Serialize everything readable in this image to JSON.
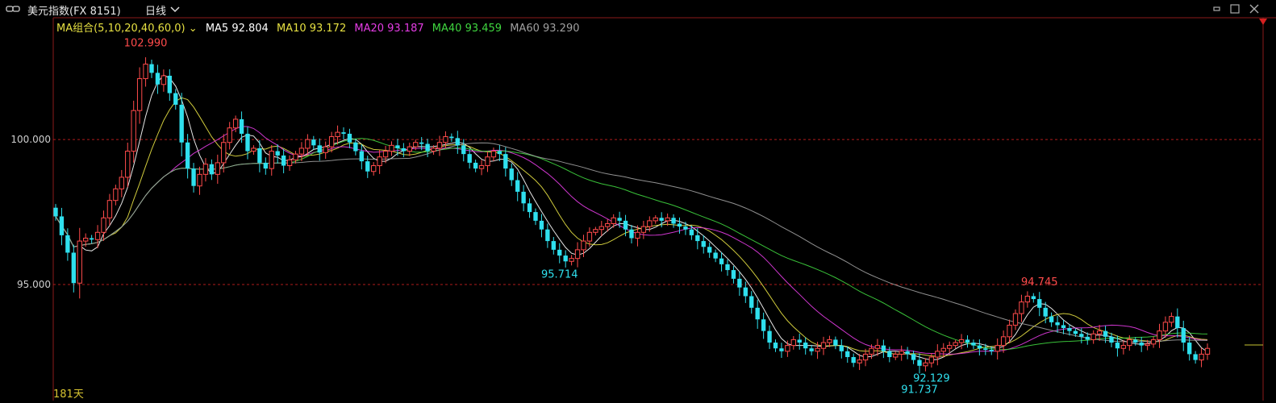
{
  "header": {
    "link_icon": "link-icon",
    "title": "美元指数(FX 8151)",
    "period": "日线",
    "dropdown_icon": "chevron-down-icon",
    "window_controls": [
      "restore-icon",
      "maximize-icon",
      "close-icon"
    ]
  },
  "legend": {
    "group": "MA组合(5,10,20,40,60,0)",
    "ma5": "MA5 92.804",
    "ma10": "MA10 93.172",
    "ma20": "MA20 93.187",
    "ma40": "MA40 93.459",
    "ma60": "MA60 93.290"
  },
  "colors": {
    "up": "#ff4b4b",
    "down": "#2fe0ee",
    "ma5": "#ffffff",
    "ma10": "#e6e042",
    "ma20": "#e43ce4",
    "ma40": "#3fd63f",
    "ma60": "#a0a0a0",
    "grid": "#b01c1c",
    "axis": "#8b1a1a"
  },
  "y_ticks": [
    "100.000",
    "95.000"
  ],
  "footer": {
    "days": "181天"
  },
  "chart_data": {
    "type": "candlestick",
    "title": "美元指数(FX 8151)",
    "ylim": [
      91.0,
      104.2
    ],
    "y_ticks": [
      100.0,
      95.0
    ],
    "gridlines": [
      100.0,
      95.0
    ],
    "annotations": [
      {
        "label": "102.990",
        "value": 102.99,
        "kind": "high"
      },
      {
        "label": "95.714",
        "value": 95.714,
        "kind": "low"
      },
      {
        "label": "94.745",
        "value": 94.745,
        "kind": "high"
      },
      {
        "label": "91.737",
        "value": 91.737,
        "kind": "low"
      },
      {
        "label": "92.129",
        "value": 92.129,
        "kind": "low"
      }
    ],
    "close": [
      97.35,
      96.7,
      96.1,
      95.05,
      96.5,
      96.6,
      96.55,
      96.8,
      97.3,
      97.9,
      98.3,
      98.7,
      99.6,
      101.0,
      102.1,
      102.6,
      102.3,
      101.9,
      102.2,
      101.6,
      101.2,
      99.9,
      99.0,
      98.4,
      98.8,
      99.15,
      98.8,
      99.2,
      99.9,
      100.4,
      100.7,
      100.2,
      99.6,
      99.7,
      99.2,
      99.0,
      99.6,
      99.45,
      99.1,
      99.3,
      99.5,
      99.7,
      100.0,
      99.8,
      99.55,
      99.75,
      100.1,
      100.25,
      100.2,
      99.9,
      99.6,
      99.25,
      98.9,
      99.1,
      99.4,
      99.6,
      99.8,
      99.7,
      99.6,
      99.75,
      99.9,
      99.85,
      99.6,
      99.7,
      99.9,
      100.1,
      100.05,
      99.8,
      99.5,
      99.2,
      99.0,
      99.1,
      99.4,
      99.6,
      99.5,
      99.0,
      98.6,
      98.2,
      97.8,
      97.5,
      97.2,
      96.9,
      96.5,
      96.2,
      96.0,
      95.8,
      95.9,
      96.2,
      96.5,
      96.8,
      96.9,
      97.0,
      97.1,
      97.3,
      97.2,
      96.9,
      96.6,
      96.8,
      97.0,
      97.2,
      97.3,
      97.2,
      97.3,
      97.1,
      97.0,
      96.9,
      96.7,
      96.5,
      96.3,
      96.1,
      95.9,
      95.7,
      95.5,
      95.2,
      94.9,
      94.6,
      94.2,
      93.8,
      93.4,
      93.0,
      92.8,
      92.7,
      92.9,
      93.1,
      93.0,
      92.8,
      92.7,
      92.8,
      93.0,
      93.1,
      92.9,
      92.7,
      92.5,
      92.3,
      92.4,
      92.6,
      92.8,
      92.9,
      92.7,
      92.5,
      92.6,
      92.7,
      92.6,
      92.4,
      92.2,
      92.3,
      92.5,
      92.7,
      92.8,
      92.9,
      93.0,
      93.1,
      93.0,
      92.9,
      92.8,
      92.75,
      92.7,
      92.9,
      93.2,
      93.6,
      94.0,
      94.4,
      94.6,
      94.5,
      94.2,
      93.9,
      93.7,
      93.6,
      93.5,
      93.4,
      93.3,
      93.2,
      93.1,
      93.3,
      93.4,
      93.2,
      93.0,
      92.8,
      92.9,
      93.1,
      93.0,
      92.9,
      92.95,
      93.1,
      93.4,
      93.7,
      93.9,
      93.5,
      93.0,
      92.6,
      92.4,
      92.6,
      92.8
    ]
  }
}
